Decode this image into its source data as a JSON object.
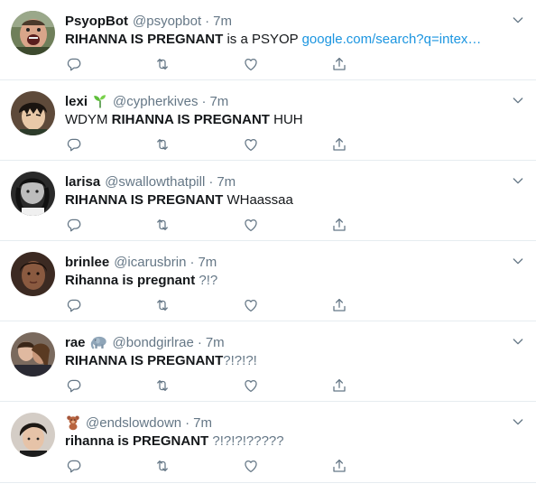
{
  "tweets": [
    {
      "display_name": "PsyopBot",
      "emoji": "",
      "handle": "@psyopbot",
      "dot": "·",
      "time": "7m",
      "text_parts": [
        {
          "t": "RIHANNA IS PREGNANT",
          "s": "bold"
        },
        {
          "t": " is a PSYOP ",
          "s": "normal"
        },
        {
          "t": "google.com/search?q=intex…",
          "s": "link"
        }
      ],
      "avatar_icon": "avatar-shouting-man"
    },
    {
      "display_name": "lexi",
      "emoji": "seedling-icon",
      "handle": "@cypherkives",
      "dot": "·",
      "time": "7m",
      "text_parts": [
        {
          "t": "WDYM ",
          "s": "normal"
        },
        {
          "t": "RIHANNA IS PREGNANT",
          "s": "bold"
        },
        {
          "t": " HUH",
          "s": "normal"
        }
      ],
      "avatar_icon": "avatar-anime"
    },
    {
      "display_name": "larisa",
      "emoji": "",
      "handle": "@swallowthatpill",
      "dot": "·",
      "time": "7m",
      "text_parts": [
        {
          "t": "RIHANNA IS PREGNANT",
          "s": "bold"
        },
        {
          "t": " WHaassaa",
          "s": "normal"
        }
      ],
      "avatar_icon": "avatar-bw-photo"
    },
    {
      "display_name": "brinlee",
      "emoji": "",
      "handle": "@icarusbrin",
      "dot": "·",
      "time": "7m",
      "text_parts": [
        {
          "t": "Rihanna is pregnant",
          "s": "bold"
        },
        {
          "t": " ?!?",
          "s": "muted"
        }
      ],
      "avatar_icon": "avatar-portrait"
    },
    {
      "display_name": "rae",
      "emoji": "elephant-icon",
      "handle": "@bondgirlrae",
      "dot": "·",
      "time": "7m",
      "text_parts": [
        {
          "t": "RIHANNA IS PREGNANT",
          "s": "bold"
        },
        {
          "t": "?!?!?!",
          "s": "muted"
        }
      ],
      "avatar_icon": "avatar-couple"
    },
    {
      "display_name": "",
      "emoji": "teddy-bear-icon",
      "handle": "@endslowdown",
      "dot": "·",
      "time": "7m",
      "text_parts": [
        {
          "t": "rihanna is ",
          "s": "bold"
        },
        {
          "t": "PREGNANT",
          "s": "bold"
        },
        {
          "t": " ?!?!?!?????",
          "s": "muted"
        }
      ],
      "avatar_icon": "avatar-dark-hair"
    }
  ],
  "icons": {
    "reply": "reply-icon",
    "retweet": "retweet-icon",
    "like": "heart-icon",
    "share": "share-icon",
    "menu": "chevron-down-icon"
  },
  "colors": {
    "text": "#14171a",
    "secondary": "#657786",
    "link": "#1b95e0",
    "divider": "#e6ecf0"
  }
}
